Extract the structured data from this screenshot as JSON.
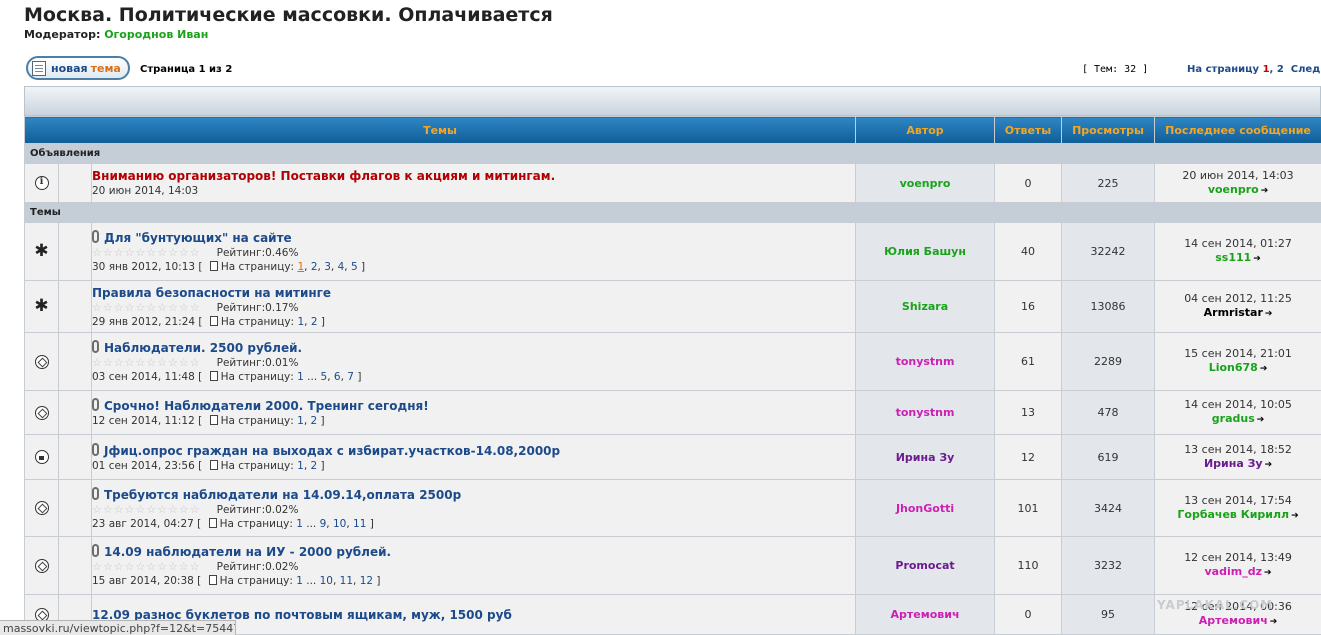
{
  "forum_title": "Москва. Политические массовки. Оплачивается",
  "moderator_label": "Модератор:",
  "moderator_name": "Огороднов Иван",
  "new_topic_btn": {
    "part1": "новая",
    "part2": "тема"
  },
  "page_of": "Страница 1 из 2",
  "topics_count": "[ Тем: 32 ]",
  "pager": {
    "label": "На страницу",
    "current": "1",
    "next_page": "2",
    "next": "След."
  },
  "columns": {
    "topics": "Темы",
    "author": "Автор",
    "replies": "Ответы",
    "views": "Просмотры",
    "last": "Последнее сообщение"
  },
  "colors": {
    "header_text": "#f5a623",
    "green_user": "#1aa31a",
    "magenta_user": "#cc1fb3",
    "purple_user": "#6a1b8e"
  },
  "sections": {
    "announcements": "Объявления",
    "topics": "Темы"
  },
  "rating_label": "Рейтинг:",
  "goto_page_label": "На страницу:",
  "announcement": {
    "icon": "info-icon",
    "title": "Вниманию организаторов! Поставки флагов к акциям и митингам.",
    "date": "20 июн 2014, 14:03",
    "author": "voenpro",
    "author_color": "#1aa31a",
    "replies": "0",
    "views": "225",
    "last_time": "20 июн 2014, 14:03",
    "last_user": "voenpro",
    "last_color": "#1aa31a"
  },
  "topics": [
    {
      "icon": "hot",
      "attach": true,
      "title": "Для \"бунтующих\" на сайте",
      "rating": "0.46%",
      "date": "30 янв 2012, 10:13",
      "pages": [
        "1",
        ", ",
        "2",
        ", ",
        "3",
        ", ",
        "4",
        ", ",
        "5"
      ],
      "visited_first": true,
      "author": "Юлия Башун",
      "author_color": "#1aa31a",
      "replies": "40",
      "views": "32242",
      "last_time": "14 сен 2014, 01:27",
      "last_user": "ss111",
      "last_color": "#1aa31a"
    },
    {
      "icon": "hot-lock",
      "attach": false,
      "title": "Правила безопасности на митинге",
      "rating": "0.17%",
      "date": "29 янв 2012, 21:24",
      "pages": [
        "1",
        ", ",
        "2"
      ],
      "visited_first": false,
      "author": "Shizara",
      "author_color": "#1aa31a",
      "replies": "16",
      "views": "13086",
      "last_time": "04 сен 2012, 11:25",
      "last_user": "Armristar",
      "last_color": "#000000"
    },
    {
      "icon": "normal",
      "attach": true,
      "title": "Наблюдатели. 2500 рублей.",
      "rating": "0.01%",
      "date": "03 сен 2014, 11:48",
      "pages": [
        "1",
        " ... ",
        "5",
        ", ",
        "6",
        ", ",
        "7"
      ],
      "visited_first": false,
      "author": "tonystnm",
      "author_color": "#cc1fb3",
      "replies": "61",
      "views": "2289",
      "last_time": "15 сен 2014, 21:01",
      "last_user": "Lion678",
      "last_color": "#1aa31a"
    },
    {
      "icon": "normal",
      "attach": true,
      "title": "Срочно! Наблюдатели 2000. Тренинг сегодня!",
      "rating": "",
      "date": "12 сен 2014, 11:12",
      "pages": [
        "1",
        ", ",
        "2"
      ],
      "visited_first": false,
      "author": "tonystnm",
      "author_color": "#cc1fb3",
      "replies": "13",
      "views": "478",
      "last_time": "14 сен 2014, 10:05",
      "last_user": "gradus",
      "last_color": "#1aa31a"
    },
    {
      "icon": "lock",
      "attach": true,
      "title": "Jфиц.опрос граждан на выходах с избират.участков-14.08,2000р",
      "rating": "",
      "date": "01 сен 2014, 23:56",
      "pages": [
        "1",
        ", ",
        "2"
      ],
      "visited_first": false,
      "author": "Ирина Зу",
      "author_color": "#6a1b8e",
      "replies": "12",
      "views": "619",
      "last_time": "13 сен 2014, 18:52",
      "last_user": "Ирина Зу",
      "last_color": "#6a1b8e"
    },
    {
      "icon": "normal",
      "attach": true,
      "title": "Требуются наблюдатели на 14.09.14,оплата 2500р",
      "rating": "0.02%",
      "date": "23 авг 2014, 04:27",
      "pages": [
        "1",
        " ... ",
        "9",
        ", ",
        "10",
        ", ",
        "11"
      ],
      "visited_first": false,
      "author": "JhonGotti",
      "author_color": "#cc1fb3",
      "replies": "101",
      "views": "3424",
      "last_time": "13 сен 2014, 17:54",
      "last_user": "Горбачев Кирилл",
      "last_color": "#1aa31a"
    },
    {
      "icon": "normal",
      "attach": true,
      "title": "14.09 наблюдатели на ИУ - 2000 рублей.",
      "rating": "0.02%",
      "date": "15 авг 2014, 20:38",
      "pages": [
        "1",
        " ... ",
        "10",
        ", ",
        "11",
        ", ",
        "12"
      ],
      "visited_first": false,
      "author": "Promocat",
      "author_color": "#6a1b8e",
      "replies": "110",
      "views": "3232",
      "last_time": "12 сен 2014, 13:49",
      "last_user": "vadim_dz",
      "last_color": "#cc1fb3"
    },
    {
      "icon": "normal",
      "attach": false,
      "title": "12.09 разнос буклетов по почтовым ящикам, муж, 1500 руб",
      "rating": "",
      "date": "",
      "pages": [],
      "visited_first": false,
      "author": "Артемович",
      "author_color": "#cc1fb3",
      "replies": "0",
      "views": "95",
      "last_time": "12 сен 2014, 00:36",
      "last_user": "Артемович",
      "last_color": "#cc1fb3"
    }
  ],
  "status_url": "massovki.ru/viewtopic.php?f=12&t=75447",
  "watermark": "YAPLAKAL.COM"
}
